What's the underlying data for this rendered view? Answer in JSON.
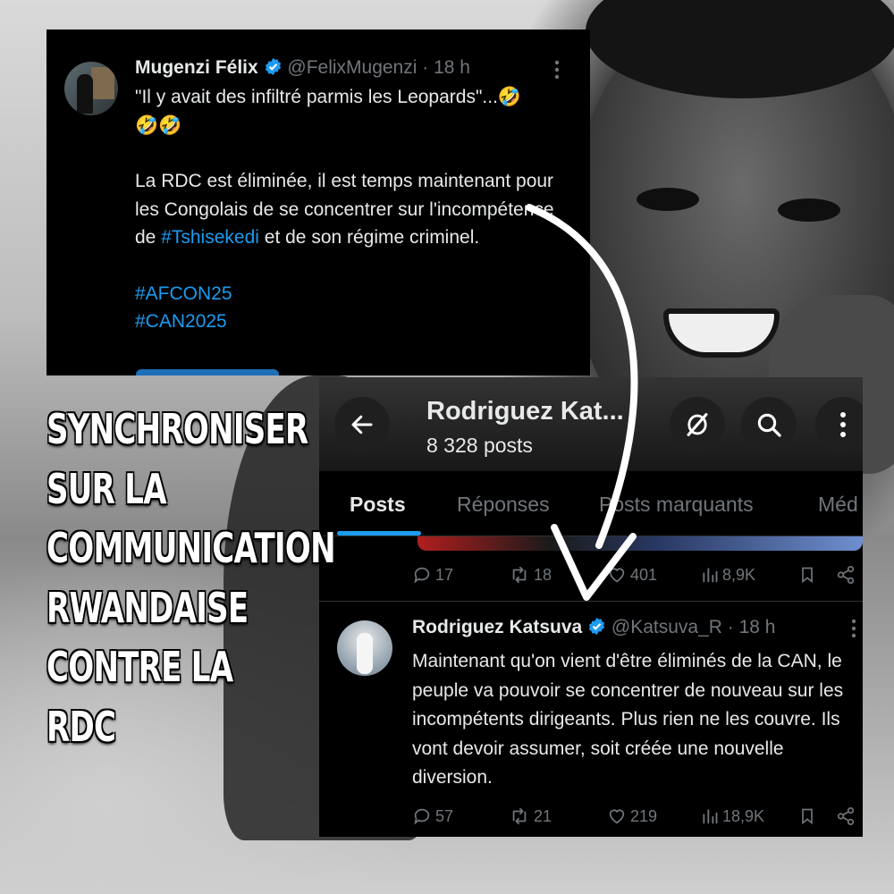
{
  "tweet1": {
    "name": "Mugenzi Félix",
    "handle": "@FelixMugenzi",
    "time": "· 18 h",
    "line1": "\"Il y avait des infiltré parmis les Leopards\"...🤣",
    "line2": "🤣🤣",
    "para_before": "La RDC est éliminée, il est temps maintenant pour les Congolais de se concentrer sur l'incompétence de ",
    "hashtag_inline": "#Tshisekedi",
    "para_after": " et de son régime criminel.",
    "hashtag1": "#AFCON25",
    "hashtag2": "#CAN2025"
  },
  "profile": {
    "name": "Rodriguez Kat...",
    "posts_count": "8 328 posts",
    "tabs": [
      {
        "label": "Posts",
        "active": true
      },
      {
        "label": "Réponses",
        "active": false
      },
      {
        "label": "Posts marquants",
        "active": false
      },
      {
        "label": "Méd",
        "active": false
      }
    ]
  },
  "pinned_actions": {
    "replies": "17",
    "reposts": "18",
    "likes": "401",
    "views": "8,9K"
  },
  "tweet2": {
    "name": "Rodriguez Katsuva",
    "handle": "@Katsuva_R",
    "time": "· 18 h",
    "text": "Maintenant qu'on vient d'être éliminés de la CAN, le peuple va pouvoir se concentrer de nouveau sur les incompétents dirigeants. Plus rien ne les couvre. Ils vont devoir assumer, soit créée une nouvelle diversion.",
    "replies": "57",
    "reposts": "21",
    "likes": "219",
    "views": "18,9K"
  },
  "headline": {
    "lines": [
      "SYNCHRONISER",
      "SUR LA",
      "COMMUNICATION",
      "RWANDAISE",
      "CONTRE LA",
      "RDC"
    ]
  },
  "colors": {
    "link": "#1d9bf0",
    "verified": "#1d9bf0",
    "card_bg": "#000000",
    "muted": "#71767b"
  },
  "icons": [
    "verified-badge-icon",
    "more-dots-icon",
    "back-arrow-icon",
    "notification-bell-slash-icon",
    "search-icon",
    "reply-icon",
    "repost-icon",
    "like-icon",
    "views-icon",
    "bookmark-icon",
    "share-icon"
  ]
}
